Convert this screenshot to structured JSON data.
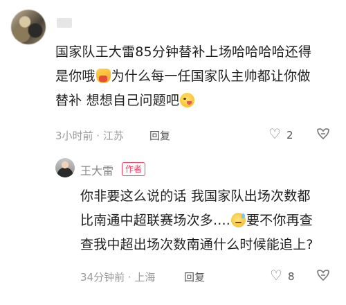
{
  "comment1": {
    "avatar_icon": "blurred-avatar",
    "line1": "国家队王大雷85分钟替补上场哈哈哈哈还得",
    "line2a": "是你哦",
    "line2b": "为什么每一任国家队主帅都让你做",
    "line3a": "替补 想想自己问题吧",
    "meta": "3小时前 · 江苏",
    "reply": "回复",
    "likes": "2"
  },
  "comment2": {
    "author": "王大雷",
    "badge": "作者",
    "line1": "你非要这么说的话 我国家队出场次数都",
    "line2a": "比南通中超联赛场次多....",
    "line2b": "要不你再查",
    "line3": "查我中超出场次数南通什么时候能追上?",
    "meta": "34分钟前 · 上海",
    "reply": "回复",
    "likes": "8"
  }
}
